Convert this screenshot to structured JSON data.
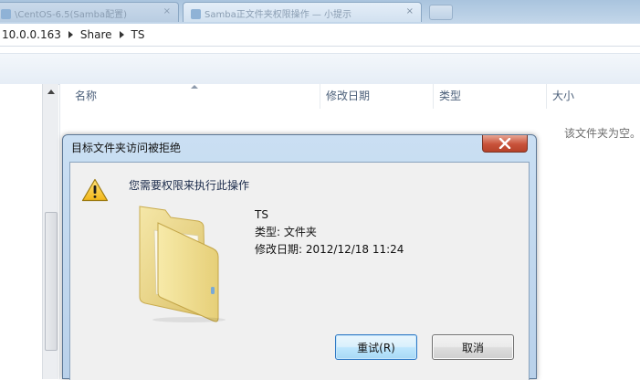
{
  "tabs": [
    {
      "label": "\\CentOS-6.5(Samba配置)",
      "close": "×"
    },
    {
      "label": "Samba正文件夹权限操作 — 小提示",
      "close": "×"
    }
  ],
  "breadcrumb": [
    "10.0.0.163",
    "Share",
    "TS"
  ],
  "columns": {
    "name": "名称",
    "date": "修改日期",
    "type": "类型",
    "size": "大小"
  },
  "empty_message": "该文件夹为空。",
  "dialog": {
    "title": "目标文件夹访问被拒绝",
    "message": "您需要权限来执行此操作",
    "item_name": "TS",
    "item_type": "类型: 文件夹",
    "item_modified": "修改日期: 2012/12/18 11:24",
    "retry_label": "重试(R)",
    "cancel_label": "取消"
  },
  "icons": {
    "warning": "warning-icon",
    "folder": "folder-icon",
    "close": "close-icon"
  },
  "colors": {
    "dialog_frame": "#b9d1ea",
    "close_button": "#c8523a",
    "default_button_border": "#2d78c4"
  }
}
